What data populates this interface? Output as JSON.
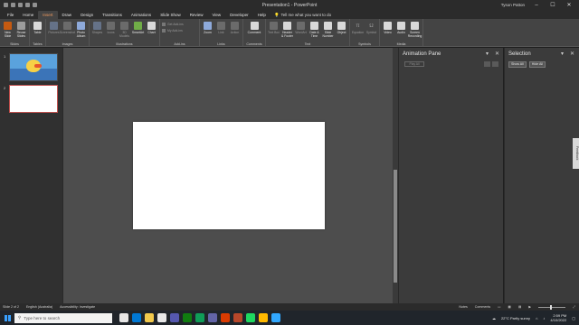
{
  "window": {
    "title": "Presentation1 - PowerPoint",
    "user": "Tyson Patton"
  },
  "tabs": [
    "File",
    "Home",
    "Insert",
    "Draw",
    "Design",
    "Transitions",
    "Animations",
    "Slide Show",
    "Review",
    "View",
    "Developer",
    "Help"
  ],
  "active_tab": "Insert",
  "tell_me": "Tell me what you want to do",
  "ribbon": {
    "groups": [
      {
        "name": "Slides",
        "buttons": [
          "New Slide",
          "Reuse Slides"
        ]
      },
      {
        "name": "Tables",
        "buttons": [
          "Table"
        ]
      },
      {
        "name": "Images",
        "buttons": [
          "Pictures",
          "Screenshot",
          "Photo Album"
        ]
      },
      {
        "name": "Illustrations",
        "buttons": [
          "Shapes",
          "Icons",
          "3D Models",
          "SmartArt",
          "Chart"
        ]
      },
      {
        "name": "Add-ins",
        "buttons": [
          "Get Add-ins",
          "My Add-ins"
        ]
      },
      {
        "name": "Links",
        "buttons": [
          "Zoom",
          "Link",
          "Action"
        ]
      },
      {
        "name": "Comments",
        "buttons": [
          "Comment"
        ]
      },
      {
        "name": "Text",
        "buttons": [
          "Text Box",
          "Header & Footer",
          "WordArt",
          "Date & Time",
          "Slide Number",
          "Object"
        ]
      },
      {
        "name": "Symbols",
        "buttons": [
          "Equation",
          "Symbol"
        ]
      },
      {
        "name": "Media",
        "buttons": [
          "Video",
          "Audio",
          "Screen Recording"
        ]
      }
    ]
  },
  "slides": [
    {
      "number": "1"
    },
    {
      "number": "2"
    }
  ],
  "animation_pane": {
    "title": "Animation Pane",
    "play_label": "Play All"
  },
  "selection_pane": {
    "title": "Selection",
    "show_all": "Show All",
    "hide_all": "Hide All"
  },
  "status": {
    "slide_info": "Slide 2 of 2",
    "language": "English (Australia)",
    "accessibility": "Accessibility: Investigate",
    "notes": "Notes",
    "comments": "Comments"
  },
  "taskbar": {
    "search_placeholder": "Type here to search",
    "weather": "22°C Partly sunny",
    "time": "2:59 PM",
    "date": "4/10/2022"
  },
  "colors": {
    "accent": "#f29a5f",
    "ribbon": "#444444",
    "canvas": "#4d4d4d"
  }
}
